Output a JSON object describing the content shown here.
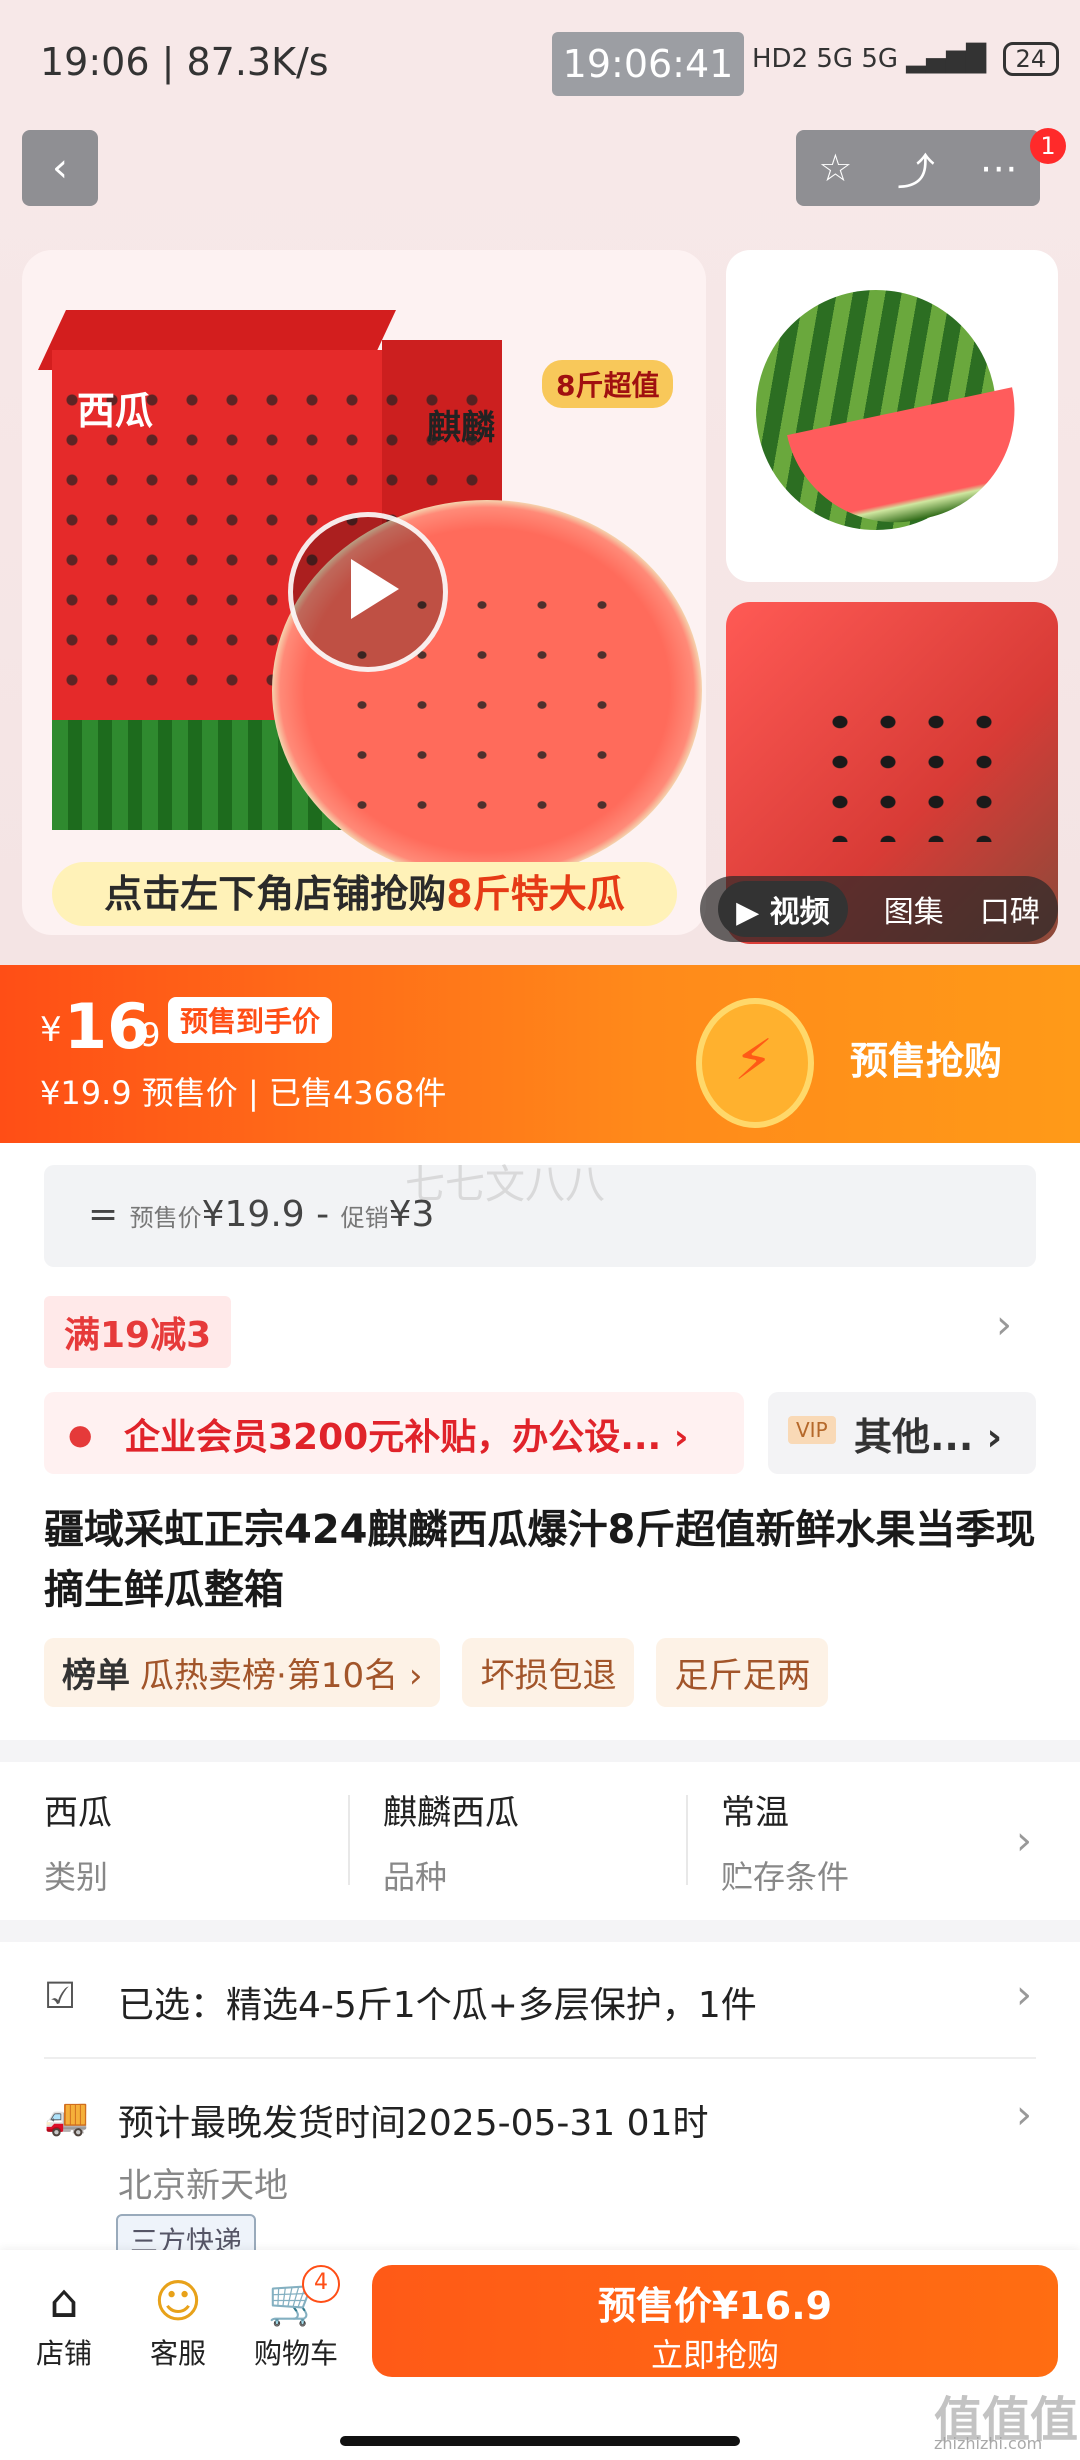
{
  "status_bar": {
    "left_text": "19:06 | 87.3K/s",
    "center_time": "19:06:41",
    "network": "HD2 5G 5G",
    "battery": "24"
  },
  "header": {
    "back_icon": "chevron-left-icon",
    "action_icons": [
      "star-icon",
      "share-icon",
      "more-icon"
    ],
    "notification_count": "1"
  },
  "hero": {
    "box_badge": "8斤超值",
    "brand_right": "麒麟",
    "brand_left": "西瓜",
    "banner_prefix": "点击左下角店铺抢购",
    "banner_highlight": "8斤特大瓜",
    "media_tabs": [
      "视频",
      "图集",
      "口碑"
    ]
  },
  "price": {
    "symbol": "¥",
    "integer": "16",
    "decimal": ".9",
    "tag": "预售到手价",
    "original": "¥19.9",
    "original_label": "预售价",
    "sold": "已售4368件",
    "cta": "预售抢购"
  },
  "breakdown": {
    "equals": "=",
    "presale_label": "预售价",
    "presale_value": "¥19.9",
    "minus": "-",
    "promo_label": "促销",
    "promo_value": "¥3",
    "watermark": "七七文八八"
  },
  "promotions": {
    "coupon": "满19减3",
    "subsidy": "企业会员3200元补贴，办公设...",
    "vip_badge": "VIP",
    "other": "其他..."
  },
  "product": {
    "title": "疆域采虹正宗424麒麟西瓜爆汁8斤超值新鲜水果当季现摘生鲜瓜整箱",
    "chips": [
      {
        "bold": "榜单",
        "text": "瓜热卖榜·第10名 ›"
      },
      {
        "bold": "",
        "text": "坏损包退"
      },
      {
        "bold": "",
        "text": "足斤足两"
      }
    ]
  },
  "attributes": [
    {
      "value": "西瓜",
      "key": "类别"
    },
    {
      "value": "麒麟西瓜",
      "key": "品种"
    },
    {
      "value": "常温",
      "key": "贮存条件"
    }
  ],
  "selection": {
    "text": "已选：精选4-5斤1个瓜+多层保护，1件"
  },
  "shipping": {
    "text": "预计最晚发货时间2025-05-31 01时",
    "location": "北京新天地",
    "express": "三方快递"
  },
  "bottom_bar": {
    "items": [
      {
        "icon": "store-icon",
        "label": "店铺"
      },
      {
        "icon": "service-icon",
        "label": "客服"
      },
      {
        "icon": "cart-icon",
        "label": "购物车"
      }
    ],
    "cart_count": "4",
    "buy_price": "预售价¥16.9",
    "buy_label": "立即抢购"
  },
  "watermark_corner": {
    "logo": "值值值",
    "url": "zhizhizhi.com"
  },
  "colors": {
    "accent": "#ff5a17",
    "promo_red": "#e0232a"
  }
}
